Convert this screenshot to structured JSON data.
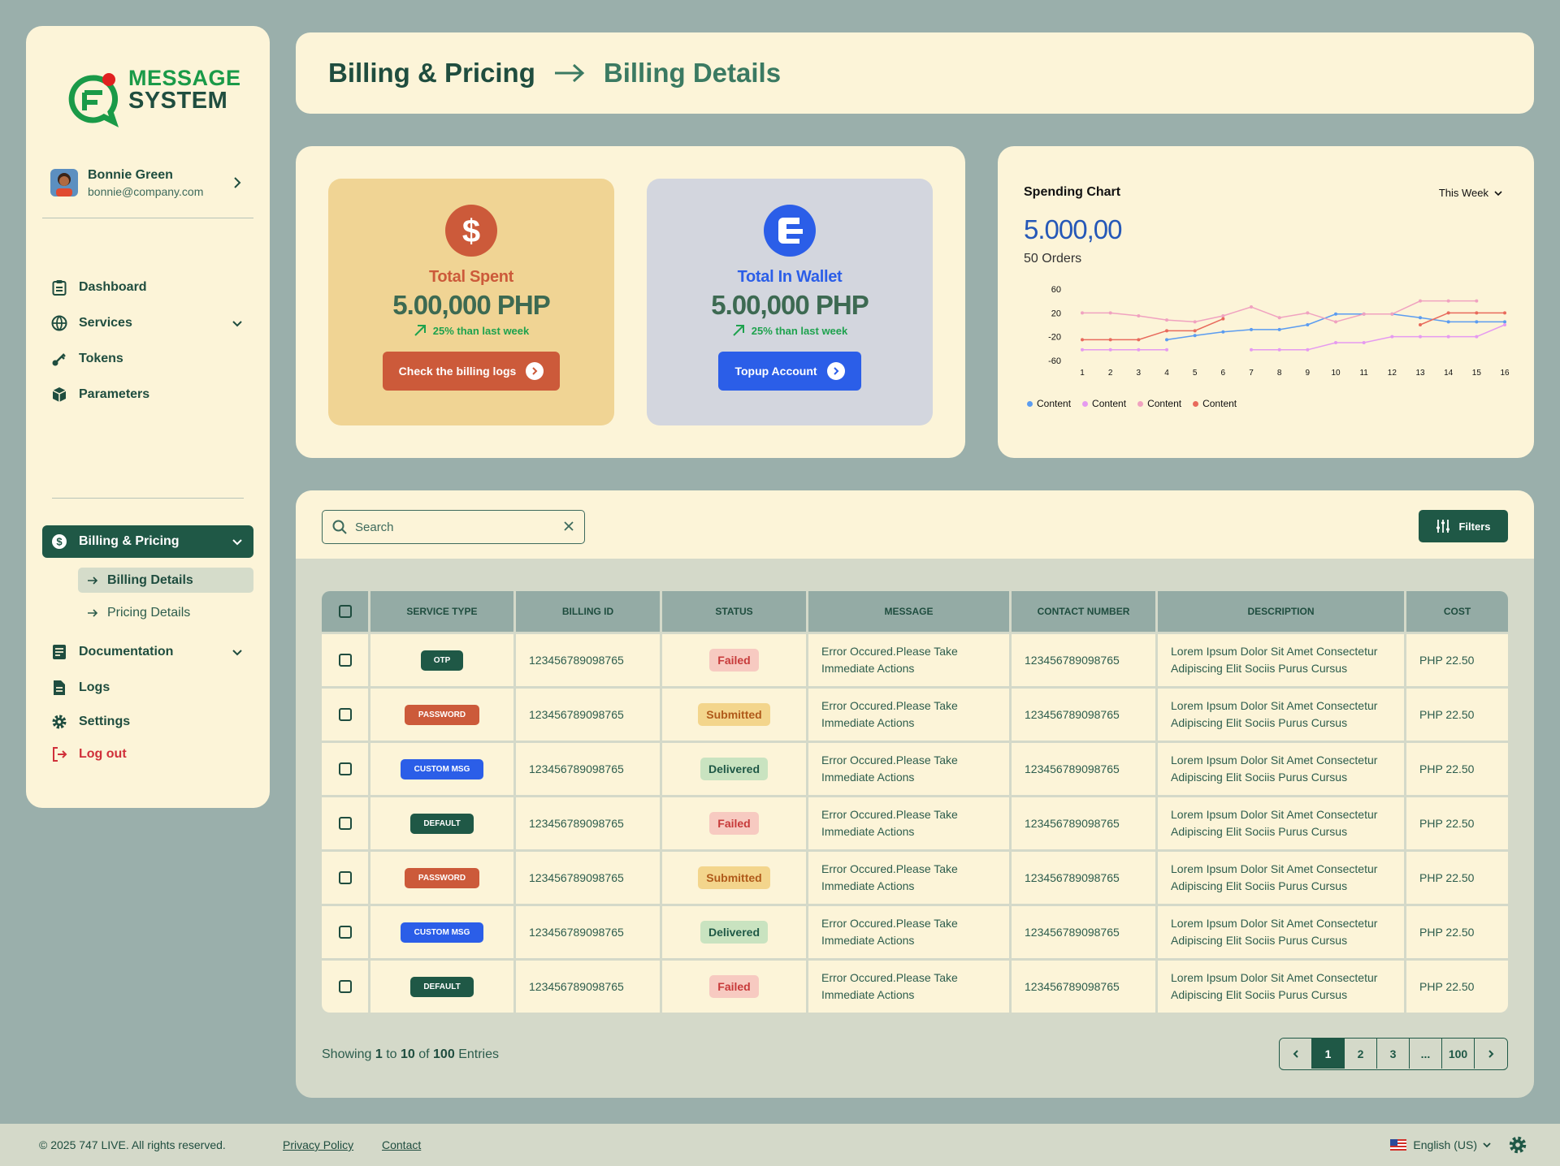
{
  "brand": {
    "line1": "MESSAGE",
    "line2": "SYSTEM"
  },
  "profile": {
    "name": "Bonnie Green",
    "email": "bonnie@company.com"
  },
  "nav": {
    "dashboard": "Dashboard",
    "services": "Services",
    "tokens": "Tokens",
    "parameters": "Parameters",
    "billing": "Billing & Pricing",
    "billing_details": "Billing Details",
    "pricing_details": "Pricing Details",
    "documentation": "Documentation",
    "logs": "Logs",
    "settings": "Settings",
    "logout": "Log out"
  },
  "header": {
    "crumb1": "Billing & Pricing",
    "crumb2": "Billing Details"
  },
  "stats": {
    "spent": {
      "title": "Total Spent",
      "value": "5.00,000 PHP",
      "trend": "25% than last week",
      "button": "Check the billing logs"
    },
    "wallet": {
      "title": "Total In Wallet",
      "value": "5.00,000 PHP",
      "trend": "25% than last week",
      "button": "Topup Account"
    }
  },
  "chart": {
    "title": "Spending Chart",
    "range": "This Week",
    "big_value": "5.000,00",
    "orders": "50 Orders"
  },
  "chart_data": {
    "type": "line",
    "x": [
      1,
      2,
      3,
      4,
      5,
      6,
      7,
      8,
      9,
      10,
      11,
      12,
      13,
      14,
      15,
      16
    ],
    "yticks": [
      60,
      20,
      -20,
      -60
    ],
    "ylim": [
      -60,
      60
    ],
    "legend_position": "bottom-left",
    "series": [
      {
        "name": "Content",
        "color": "#5b9cf0",
        "values": [
          null,
          null,
          null,
          -25,
          -18,
          -12,
          -8,
          -8,
          0,
          18,
          18,
          18,
          12,
          5,
          5,
          5
        ]
      },
      {
        "name": "Content",
        "color": "#e59af0",
        "values": [
          -42,
          -42,
          -42,
          -42,
          null,
          null,
          -42,
          -42,
          -42,
          -30,
          -30,
          -20,
          -20,
          -20,
          -20,
          0
        ]
      },
      {
        "name": "Content",
        "color": "#f0a2c0",
        "values": [
          20,
          20,
          15,
          8,
          5,
          15,
          30,
          12,
          20,
          5,
          18,
          18,
          40,
          40,
          40,
          null
        ]
      },
      {
        "name": "Content",
        "color": "#e86a5c",
        "values": [
          -25,
          -25,
          -25,
          -10,
          -10,
          10,
          null,
          null,
          null,
          null,
          null,
          null,
          0,
          20,
          20,
          20
        ]
      }
    ]
  },
  "table": {
    "search_placeholder": "Search",
    "filters": "Filters",
    "headers": [
      "Service Type",
      "Billing ID",
      "Status",
      "Message",
      "Contact Number",
      "Description",
      "Cost"
    ],
    "rows": [
      {
        "type": "OTP",
        "id": "123456789098765",
        "status": "Failed",
        "msg1": "Error Occured.Please Take",
        "msg2": "Immediate Actions",
        "contact": "123456789098765",
        "desc1": "Lorem Ipsum Dolor Sit Amet Consectetur",
        "desc2": "Adipiscing Elit Sociis Purus Cursus",
        "cost": "PHP 22.50"
      },
      {
        "type": "PASSWORD",
        "id": "123456789098765",
        "status": "Submitted",
        "msg1": "Error Occured.Please Take",
        "msg2": "Immediate Actions",
        "contact": "123456789098765",
        "desc1": "Lorem Ipsum Dolor Sit Amet Consectetur",
        "desc2": "Adipiscing Elit Sociis Purus Cursus",
        "cost": "PHP 22.50"
      },
      {
        "type": "CUSTOM MSG",
        "id": "123456789098765",
        "status": "Delivered",
        "msg1": "Error Occured.Please Take",
        "msg2": "Immediate Actions",
        "contact": "123456789098765",
        "desc1": "Lorem Ipsum Dolor Sit Amet Consectetur",
        "desc2": "Adipiscing Elit Sociis Purus Cursus",
        "cost": "PHP 22.50"
      },
      {
        "type": "DEFAULT",
        "id": "123456789098765",
        "status": "Failed",
        "msg1": "Error Occured.Please Take",
        "msg2": "Immediate Actions",
        "contact": "123456789098765",
        "desc1": "Lorem Ipsum Dolor Sit Amet Consectetur",
        "desc2": "Adipiscing Elit Sociis Purus Cursus",
        "cost": "PHP 22.50"
      },
      {
        "type": "PASSWORD",
        "id": "123456789098765",
        "status": "Submitted",
        "msg1": "Error Occured.Please Take",
        "msg2": "Immediate Actions",
        "contact": "123456789098765",
        "desc1": "Lorem Ipsum Dolor Sit Amet Consectetur",
        "desc2": "Adipiscing Elit Sociis Purus Cursus",
        "cost": "PHP 22.50"
      },
      {
        "type": "CUSTOM MSG",
        "id": "123456789098765",
        "status": "Delivered",
        "msg1": "Error Occured.Please Take",
        "msg2": "Immediate Actions",
        "contact": "123456789098765",
        "desc1": "Lorem Ipsum Dolor Sit Amet Consectetur",
        "desc2": "Adipiscing Elit Sociis Purus Cursus",
        "cost": "PHP 22.50"
      },
      {
        "type": "DEFAULT",
        "id": "123456789098765",
        "status": "Failed",
        "msg1": "Error Occured.Please Take",
        "msg2": "Immediate Actions",
        "contact": "123456789098765",
        "desc1": "Lorem Ipsum Dolor Sit Amet Consectetur",
        "desc2": "Adipiscing Elit Sociis Purus Cursus",
        "cost": "PHP 22.50"
      }
    ]
  },
  "pagination": {
    "showing": "Showing",
    "from": "1",
    "to_word": "to",
    "to": "10",
    "of_word": "of",
    "total": "100",
    "entries": "Entries",
    "pages": [
      "1",
      "2",
      "3",
      "...",
      "100"
    ]
  },
  "footer": {
    "copyright": "© 2025 747 LIVE. All rights reserved.",
    "privacy": "Privacy Policy",
    "contact": "Contact",
    "language": "English (US)"
  },
  "colors": {
    "primary": "#1f5846",
    "accent_orange": "#cc5a3a",
    "accent_blue": "#2b5ee8",
    "panel": "#fcf4d8",
    "background": "#9aafab"
  }
}
